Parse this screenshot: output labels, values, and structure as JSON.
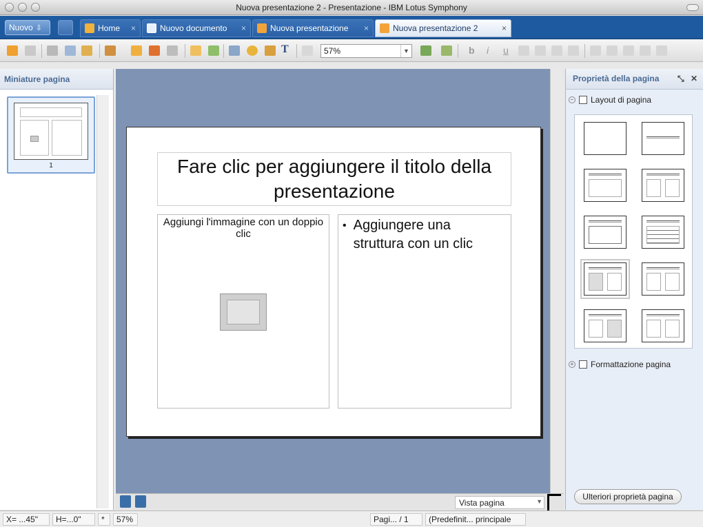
{
  "window": {
    "title": "Nuova presentazione 2 - Presentazione - IBM Lotus Symphony"
  },
  "tabbar": {
    "new_button": "Nuovo",
    "tabs": [
      {
        "label": "Home",
        "icon": "home-icon"
      },
      {
        "label": "Nuovo documento",
        "icon": "document-icon"
      },
      {
        "label": "Nuova presentazione",
        "icon": "presentation-icon"
      },
      {
        "label": "Nuova presentazione 2",
        "icon": "presentation-icon",
        "active": true
      }
    ],
    "close_glyph": "×"
  },
  "toolbar": {
    "zoom_value": "57%",
    "format_buttons": [
      "b",
      "i",
      "u"
    ]
  },
  "left_panel": {
    "title": "Miniature pagina",
    "thumbnail_number": "1"
  },
  "slide": {
    "title_placeholder": "Fare clic per aggiungere il titolo della presentazione",
    "image_placeholder": "Aggiungi l'immagine con un doppio clic",
    "outline_placeholder": "Aggiungere una struttura con un clic",
    "bullet": "•"
  },
  "canvas_footer": {
    "view_mode": "Vista pagina"
  },
  "right_panel": {
    "title": "Proprietà della pagina",
    "section_layout": "Layout di pagina",
    "section_format": "Formattazione pagina",
    "more_button": "Ulteriori proprietà pagina",
    "layout_names": [
      "blank-layout",
      "title-only-layout",
      "title-content-layout",
      "title-two-content-layout",
      "title-chart-layout",
      "title-table-layout",
      "title-image-text-layout",
      "title-text-chart-layout",
      "title-text-image-layout",
      "title-chart-text-layout"
    ]
  },
  "statusbar": {
    "x": "X= ...45\"",
    "h": "H=...0\"",
    "star": "*",
    "zoom": "57%",
    "page": "Pagi... / 1",
    "master": "(Predefinit... principale"
  },
  "colors": {
    "tabbar": "#1e5aa0",
    "canvas": "#7f94b4",
    "panel_header_text": "#4a6a94"
  }
}
